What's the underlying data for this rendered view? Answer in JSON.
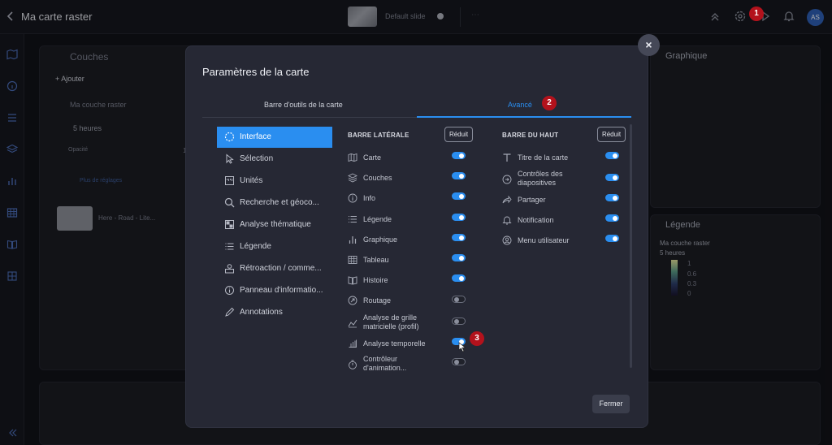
{
  "topbar": {
    "back_icon": "chevron-left-icon",
    "title": "Ma carte raster",
    "slide_label": "Default slide",
    "more": "⋯",
    "avatar_initials": "AS"
  },
  "background": {
    "layers_title": "Couches",
    "add_label": "+ Ajouter",
    "layer_name": "Ma couche raster",
    "time_value": "5 heures",
    "opacity_label": "Opacité",
    "opacity_value": "1",
    "more_settings": "Plus de réglages",
    "basemap_name": "Here - Road - Lite...",
    "chart_title": "Graphique",
    "legend_title": "Légende",
    "legend_layer": "Ma couche raster",
    "legend_sub": "5 heures",
    "legend_ticks": [
      "1",
      "0.6",
      "0.3",
      "0"
    ]
  },
  "modal": {
    "title": "Paramètres de la carte",
    "close": "×",
    "tabs": [
      "Barre d'outils de la carte",
      "Avancé"
    ],
    "active_tab": 1,
    "menu": [
      {
        "label": "Interface",
        "icon": "dashed-circle-icon",
        "active": true
      },
      {
        "label": "Sélection",
        "icon": "cursor-icon",
        "active": false
      },
      {
        "label": "Unités",
        "icon": "ruler-icon",
        "active": false
      },
      {
        "label": "Recherche et géoco...",
        "icon": "search-icon",
        "active": false
      },
      {
        "label": "Analyse thématique",
        "icon": "thematic-icon",
        "active": false
      },
      {
        "label": "Légende",
        "icon": "list-icon",
        "active": false
      },
      {
        "label": "Rétroaction / comme...",
        "icon": "feedback-icon",
        "active": false
      },
      {
        "label": "Panneau d'informatio...",
        "icon": "info-icon",
        "active": false
      },
      {
        "label": "Annotations",
        "icon": "pencil-icon",
        "active": false
      }
    ],
    "sidebar_section": {
      "title": "BARRE LATÉRALE",
      "button": "Réduit",
      "options": [
        {
          "label": "Carte",
          "icon": "map-icon",
          "on": true
        },
        {
          "label": "Couches",
          "icon": "layers-icon",
          "on": true
        },
        {
          "label": "Info",
          "icon": "info-icon",
          "on": true
        },
        {
          "label": "Légende",
          "icon": "list-icon",
          "on": true
        },
        {
          "label": "Graphique",
          "icon": "bar-chart-icon",
          "on": true
        },
        {
          "label": "Tableau",
          "icon": "table-icon",
          "on": true
        },
        {
          "label": "Histoire",
          "icon": "book-icon",
          "on": true
        },
        {
          "label": "Routage",
          "icon": "route-icon",
          "on": false
        },
        {
          "label": "Analyse de grille matricielle (profil)",
          "icon": "profile-icon",
          "on": false
        },
        {
          "label": "Analyse temporelle",
          "icon": "grid-icon",
          "on": true
        },
        {
          "label": "Contrôleur d'animation...",
          "icon": "timer-icon",
          "on": false
        }
      ]
    },
    "topbar_section": {
      "title": "BARRE DU HAUT",
      "button": "Réduit",
      "options": [
        {
          "label": "Titre de la carte",
          "icon": "title-icon",
          "on": true
        },
        {
          "label": "Contrôles des diapositives",
          "icon": "slides-icon",
          "on": true
        },
        {
          "label": "Partager",
          "icon": "share-icon",
          "on": true
        },
        {
          "label": "Notification",
          "icon": "bell-icon",
          "on": true
        },
        {
          "label": "Menu utilisateur",
          "icon": "user-icon",
          "on": true
        }
      ]
    },
    "close_button": "Fermer"
  },
  "annotations": [
    "1",
    "2",
    "3"
  ],
  "colors": {
    "accent": "#2a8ef0",
    "badge": "#b3121c"
  }
}
